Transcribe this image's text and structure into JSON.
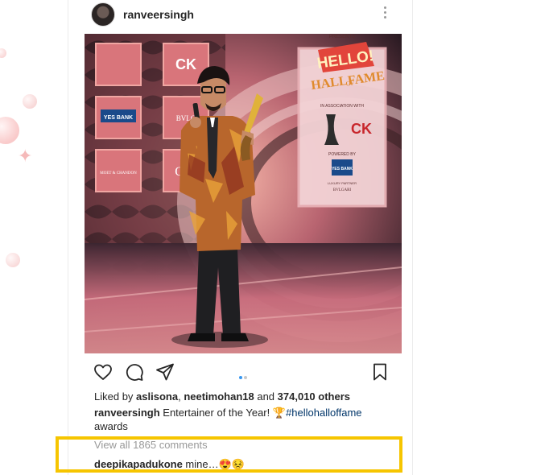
{
  "post": {
    "username": "ranveersingh",
    "likes": {
      "prefix": "Liked by ",
      "user1": "aslisona",
      "sep": ", ",
      "user2": "neetimohan18",
      "and": " and ",
      "others": "374,010 others"
    },
    "caption": {
      "user": "ranveersingh",
      "text": " Entertainer of the Year! ",
      "hashtag": "#hellohalloffame",
      "continuation": "awards"
    },
    "view_comments": "View all 1865 comments",
    "comment": {
      "user": "deepikapadukone",
      "text": " mine…",
      "emoji": "😍😣"
    }
  },
  "photo_sign": {
    "presents": "PRESENTS",
    "hello": "HELLO!",
    "hall": "HALL",
    "of": "OF",
    "fame": "FAME",
    "association": "IN ASSOCIATION WITH",
    "powered": "POWERED BY",
    "bank": "YES BANK",
    "luxury": "LUXURY PARTNER",
    "brand": "BVLGARI",
    "ck": "CK"
  },
  "backdrop_panels": {
    "p1": "",
    "p2": "CK",
    "p3": "YES BANK",
    "p4": "BVLG",
    "p5": "MOET & CHANDON",
    "p6": "O"
  },
  "icons": {
    "heart": "heart-icon",
    "comment": "comment-icon",
    "share": "send-icon",
    "save": "bookmark-icon",
    "more": "more-options-icon"
  },
  "colors": {
    "highlight": "#f6c500",
    "hashtag": "#003569",
    "dot_active": "#3897f0"
  }
}
